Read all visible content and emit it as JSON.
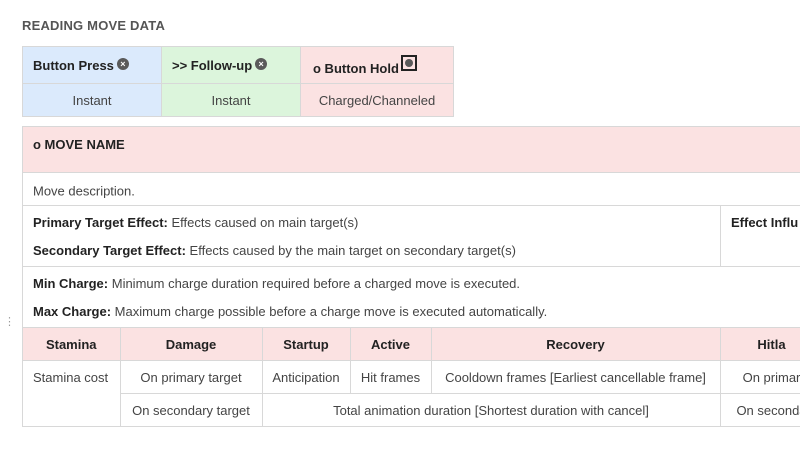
{
  "heading": "READING MOVE DATA",
  "legend": {
    "columns": [
      {
        "label": "Button Press",
        "icon": "x-circle-icon",
        "subtitle": "Instant",
        "color": "#dbeafc"
      },
      {
        "label": ">> Follow-up",
        "icon": "x-circle-icon",
        "subtitle": "Instant",
        "color": "#dcf5dc"
      },
      {
        "label": "o Button Hold",
        "icon": "boxed-circle-icon",
        "subtitle": "Charged/Channeled",
        "color": "#fbe2e2"
      }
    ]
  },
  "move": {
    "name": "o MOVE NAME",
    "description": "Move description.",
    "primary_label": "Primary Target Effect:",
    "primary_text": " Effects caused on main target(s)",
    "secondary_label": "Secondary Target Effect:",
    "secondary_text": " Effects caused by the main target on secondary target(s)",
    "effect_influence": "Effect Influ",
    "min_charge_label": "Min Charge:",
    "min_charge_text": " Minimum charge duration required before a charged move is executed.",
    "max_charge_label": "Max Charge:",
    "max_charge_text": " Maximum charge possible before a charge move is executed automatically."
  },
  "stats": {
    "headers": [
      "Stamina",
      "Damage",
      "Startup",
      "Active",
      "Recovery",
      "Hitla"
    ],
    "stamina_value": "Stamina cost",
    "row1": [
      "On primary target",
      "Anticipation",
      "Hit frames",
      "Cooldown frames [Earliest cancellable frame]",
      "On primar"
    ],
    "row2_damage": "On secondary target",
    "row2_duration": "Total animation duration [Shortest duration with cancel]",
    "row2_hitlag": "On seconda"
  },
  "colors": {
    "press": "#dbeafc",
    "followup": "#dcf5dc",
    "hold": "#fbe2e2",
    "border": "#d8d8d8"
  }
}
